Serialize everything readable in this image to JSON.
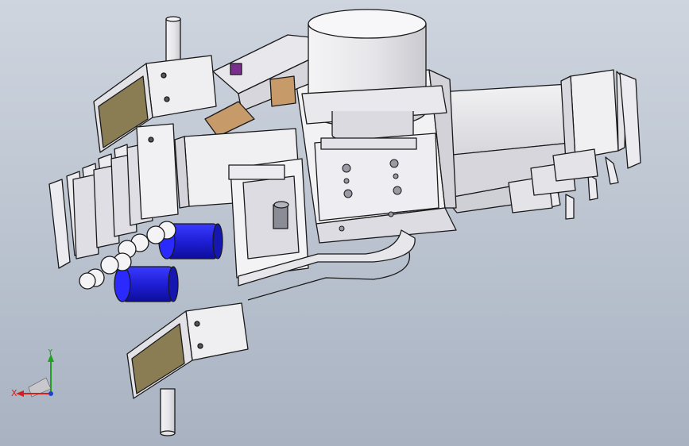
{
  "viewport": {
    "background_top": "#ced5df",
    "background_bottom": "#a8b2c1",
    "model_name": "",
    "part_colors": {
      "body": "#ececf0",
      "edge": "#1a1a1a",
      "pad": "#8a7d54",
      "motor": "#1f1fd6",
      "accent_purple": "#7a2f8e",
      "accent_tan": "#c79a6a"
    }
  },
  "triad": {
    "x_label": "X",
    "y_label": "Y",
    "x_color": "#d02020",
    "y_color": "#20a020",
    "z_color": "#2040d0"
  }
}
